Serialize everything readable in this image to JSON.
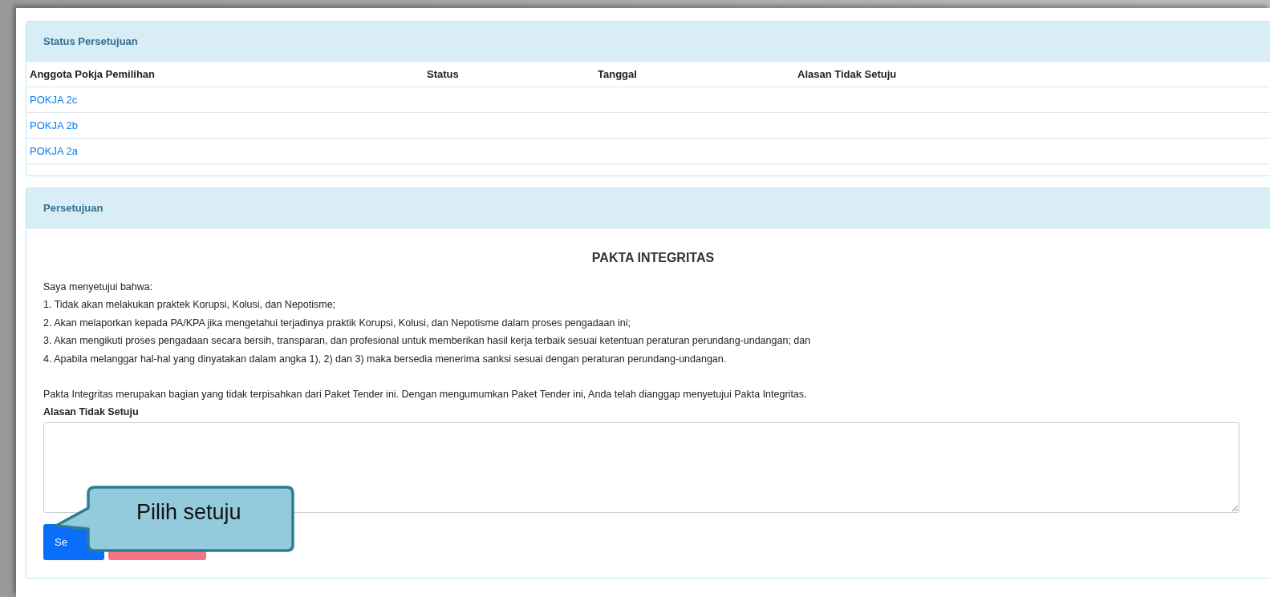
{
  "status_panel": {
    "title": "Status Persetujuan",
    "columns": [
      "Anggota Pokja Pemilihan",
      "Status",
      "Tanggal",
      "Alasan Tidak Setuju"
    ],
    "rows": [
      {
        "member": "POKJA 2c"
      },
      {
        "member": "POKJA 2b"
      },
      {
        "member": "POKJA 2a"
      }
    ]
  },
  "approval_panel": {
    "title": "Persetujuan",
    "heading": "PAKTA INTEGRITAS",
    "lines": [
      "Saya menyetujui bahwa:",
      "1. Tidak akan melakukan praktek Korupsi, Kolusi, dan Nepotisme;",
      "2. Akan melaporkan kepada PA/KPA jika mengetahui terjadinya praktik Korupsi, Kolusi, dan Nepotisme dalam proses pengadaan ini;",
      "3. Akan mengikuti proses pengadaan secara bersih, transparan, dan profesional untuk memberikan hasil kerja terbaik sesuai ketentuan peraturan perundang-undangan; dan",
      "4. Apabila melanggar hal-hal yang dinyatakan dalam angka 1), 2) dan 3) maka bersedia menerima sanksi sesuai dengan peraturan perundang-undangan."
    ],
    "note": "Pakta Integritas merupakan bagian yang tidak terpisahkan dari Paket Tender ini. Dengan mengumumkan Paket Tender ini, Anda telah dianggap menyetujui Pakta Integritas.",
    "reason_label": "Alasan Tidak Setuju",
    "buttons": [
      {
        "kind": "primary",
        "label": "Se"
      },
      {
        "kind": "danger"
      }
    ]
  },
  "callout": {
    "text": "Pilih setuju"
  }
}
